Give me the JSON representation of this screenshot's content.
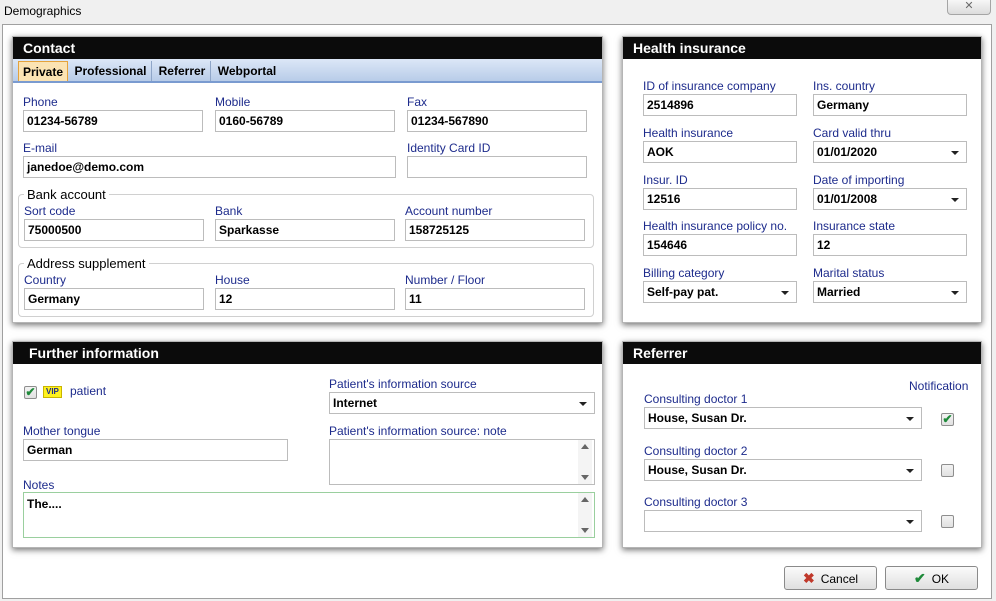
{
  "window": {
    "title": "Demographics",
    "close_glyph": "✕"
  },
  "contact": {
    "title": "Contact",
    "tabs": [
      "Private",
      "Professional",
      "Referrer",
      "Webportal"
    ],
    "phone": {
      "label": "Phone",
      "value": "01234-56789"
    },
    "mobile": {
      "label": "Mobile",
      "value": "0160-56789"
    },
    "fax": {
      "label": "Fax",
      "value": "01234-567890"
    },
    "email": {
      "label": "E-mail",
      "value": "janedoe@demo.com"
    },
    "identity": {
      "label": "Identity Card ID",
      "value": ""
    },
    "bank_account": {
      "title": "Bank account",
      "sort_code": {
        "label": "Sort code",
        "value": "75000500"
      },
      "bank": {
        "label": "Bank",
        "value": "Sparkasse"
      },
      "account_number": {
        "label": "Account number",
        "value": "158725125"
      }
    },
    "address": {
      "title": "Address supplement",
      "country": {
        "label": "Country",
        "value": "Germany"
      },
      "house": {
        "label": "House",
        "value": "12"
      },
      "number_floor": {
        "label": "Number / Floor",
        "value": "11"
      }
    }
  },
  "health": {
    "title": "Health insurance",
    "id_company": {
      "label": "ID of insurance company",
      "value": "2514896"
    },
    "ins_country": {
      "label": "Ins. country",
      "value": "Germany"
    },
    "health_insurance": {
      "label": "Health insurance",
      "value": "AOK"
    },
    "card_valid": {
      "label": "Card valid thru",
      "value": "01/01/2020"
    },
    "insur_id": {
      "label": "Insur. ID",
      "value": "12516"
    },
    "date_importing": {
      "label": "Date of importing",
      "value": "01/01/2008"
    },
    "policy_no": {
      "label": "Health insurance policy no.",
      "value": "154646"
    },
    "insurance_state": {
      "label": "Insurance state",
      "value": "12"
    },
    "billing": {
      "label": "Billing category",
      "value": "Self-pay pat."
    },
    "marital": {
      "label": "Marital status",
      "value": "Married"
    }
  },
  "further": {
    "title": "Further information",
    "vip_badge": "VIP",
    "vip_checked": true,
    "patient_label": "patient",
    "info_source": {
      "label": "Patient's information source",
      "value": "Internet"
    },
    "info_note": {
      "label": "Patient's information source: note",
      "value": ""
    },
    "mother_tongue": {
      "label": "Mother tongue",
      "value": "German"
    },
    "notes": {
      "label": "Notes",
      "value": "The...."
    }
  },
  "referrer": {
    "title": "Referrer",
    "notification_label": "Notification",
    "doctors": [
      {
        "label": "Consulting doctor 1",
        "value": "House, Susan Dr.",
        "notify": true
      },
      {
        "label": "Consulting doctor 2",
        "value": "House, Susan Dr.",
        "notify": false
      },
      {
        "label": "Consulting doctor 3",
        "value": "",
        "notify": false
      }
    ]
  },
  "buttons": {
    "cancel": "Cancel",
    "ok": "OK",
    "cancel_icon": "✖",
    "ok_icon": "✔"
  },
  "colors": {
    "label_blue": "#1d2b8c",
    "header_black": "#0b0b0b",
    "tab_active": "#fbe3b3",
    "check_green": "#1f8a3a",
    "cancel_red": "#c0392b"
  }
}
